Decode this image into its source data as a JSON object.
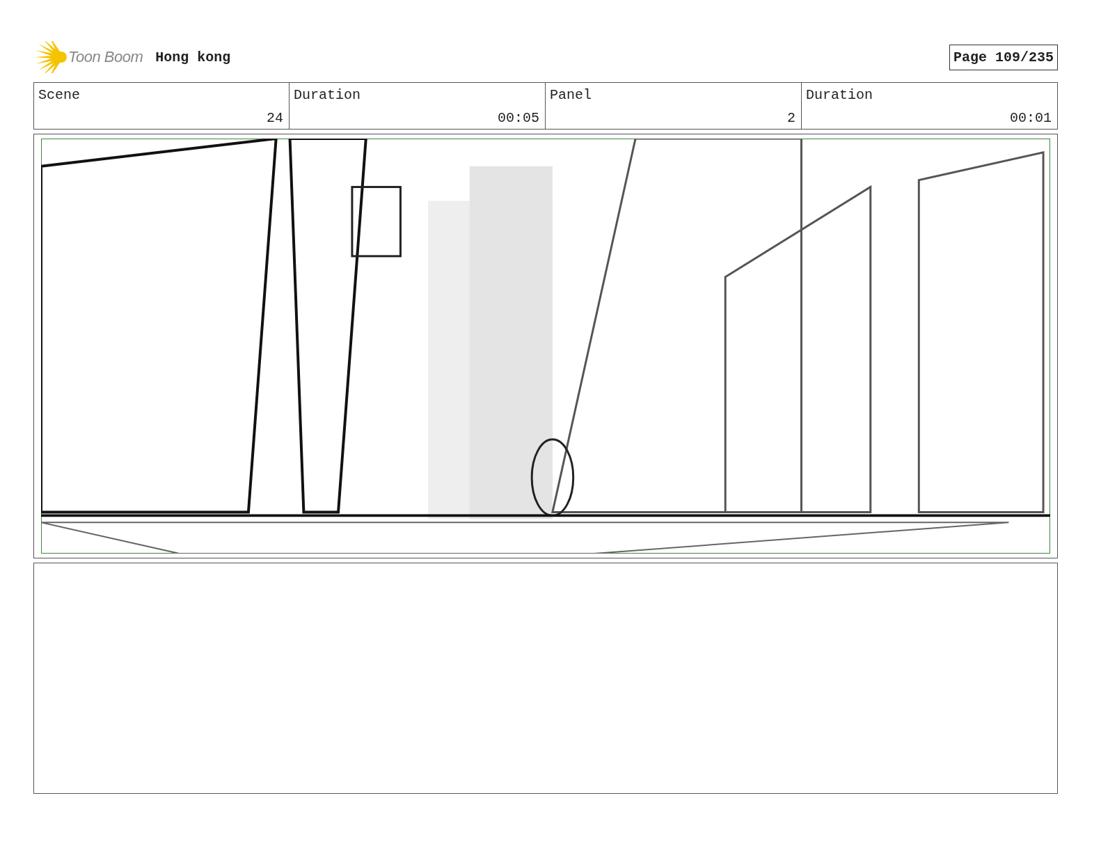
{
  "header": {
    "logo_text": "Toon Boom",
    "project": "Hong kong",
    "page": "Page 109/235"
  },
  "info": [
    {
      "heading": "Scene",
      "figure": "24"
    },
    {
      "heading": "Duration",
      "figure": "00:05"
    },
    {
      "heading": "Panel",
      "figure": "2"
    },
    {
      "heading": "Duration",
      "figure": "00:01"
    }
  ]
}
